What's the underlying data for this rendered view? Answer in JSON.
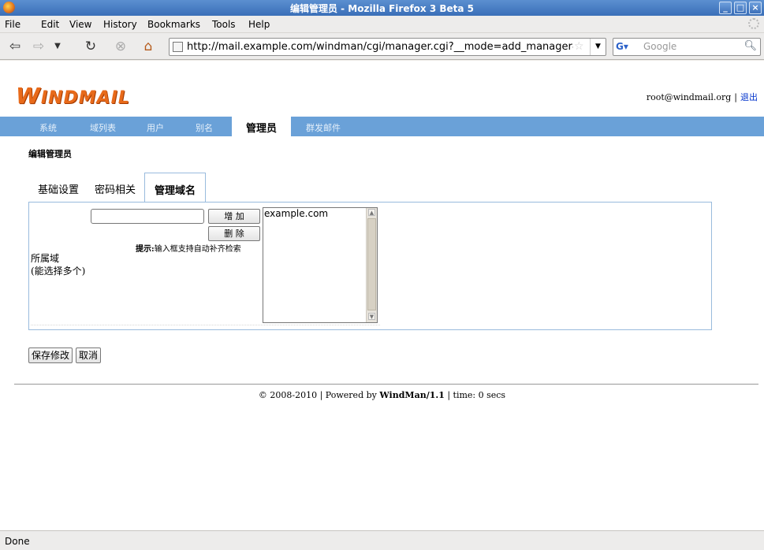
{
  "window": {
    "title": "编辑管理员 - Mozilla Firefox 3 Beta 5",
    "controls": [
      "minimize-icon",
      "maximize-icon",
      "close-icon"
    ]
  },
  "menu": [
    "File",
    "Edit",
    "View",
    "History",
    "Bookmarks",
    "Tools",
    "Help"
  ],
  "navbar": {
    "url": "http://mail.example.com/windman/cgi/manager.cgi?__mode=add_manager&",
    "search_engine": "G",
    "search_placeholder": "Google",
    "icons": [
      "back-icon",
      "forward-icon",
      "history-dropdown-icon",
      "reload-icon",
      "stop-icon",
      "home-icon"
    ]
  },
  "header": {
    "logo_first": "W",
    "logo_rest": "INDMAIL",
    "user": "root@windmail.org",
    "separator": "|",
    "logout": "退出"
  },
  "mainnav": [
    "系统",
    "域列表",
    "用户",
    "别名",
    "管理员",
    "群发邮件"
  ],
  "mainnav_active": "管理员",
  "section_title": "编辑管理员",
  "tabs": [
    "基础设置",
    "密码相关",
    "管理域名"
  ],
  "tabs_active": "管理域名",
  "form": {
    "label_line1": "所属域",
    "label_line2": "(能选择多个)",
    "domain_input_value": "",
    "add_label": "增 加",
    "delete_label": "删 除",
    "hint_bold": "提示:",
    "hint_text": "输入框支持自动补齐检索",
    "listbox_options": [
      "example.com"
    ]
  },
  "actions": {
    "save": "保存修改",
    "cancel": "取消"
  },
  "footer": {
    "prefix": "© 2008-2010 | Powered by ",
    "product": "WindMan/1.1",
    "suffix": " | time: 0 secs"
  },
  "status": "Done",
  "colors": {
    "titlebar": "#3a6fb8",
    "nav_bg": "#6aa1d8",
    "logo": "#e86a1a",
    "panel_border": "#99bbdd"
  }
}
